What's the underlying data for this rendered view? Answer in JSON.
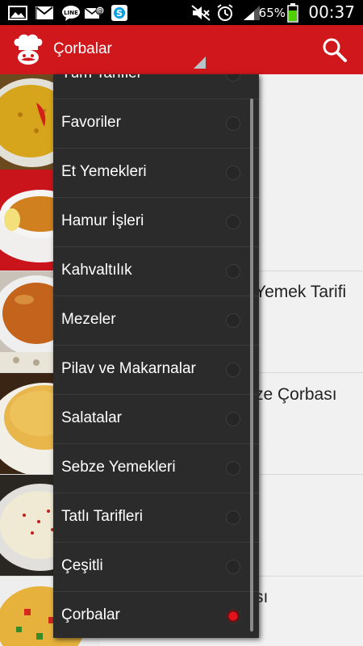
{
  "status_bar": {
    "battery_percent": "65%",
    "time": "00:37",
    "icons": [
      "image-icon",
      "gmail-icon",
      "line-icon",
      "email-icon",
      "skype-icon",
      "mute-icon",
      "alarm-icon",
      "signal-icon",
      "battery-icon"
    ]
  },
  "action_bar": {
    "title": "Çorbalar",
    "icons": [
      "chef-logo-icon",
      "search-icon"
    ],
    "color": "#d0171c"
  },
  "background_list": {
    "items": [
      {
        "text": ""
      },
      {
        "text": ""
      },
      {
        "text": "Yemek Tarifi"
      },
      {
        "text": "ze Çorbası"
      },
      {
        "text": ""
      },
      {
        "text": "sı"
      }
    ]
  },
  "dropdown": {
    "items": [
      {
        "label": "Tüm Tarifler",
        "selected": false
      },
      {
        "label": "Favoriler",
        "selected": false
      },
      {
        "label": "Et Yemekleri",
        "selected": false
      },
      {
        "label": "Hamur İşleri",
        "selected": false
      },
      {
        "label": "Kahvaltılık",
        "selected": false
      },
      {
        "label": "Mezeler",
        "selected": false
      },
      {
        "label": "Pilav ve Makarnalar",
        "selected": false
      },
      {
        "label": "Salatalar",
        "selected": false
      },
      {
        "label": "Sebze Yemekleri",
        "selected": false
      },
      {
        "label": "Tatlı Tarifleri",
        "selected": false
      },
      {
        "label": "Çeşitli",
        "selected": false
      },
      {
        "label": "Çorbalar",
        "selected": true
      }
    ],
    "selected_color": "#e0141a"
  }
}
